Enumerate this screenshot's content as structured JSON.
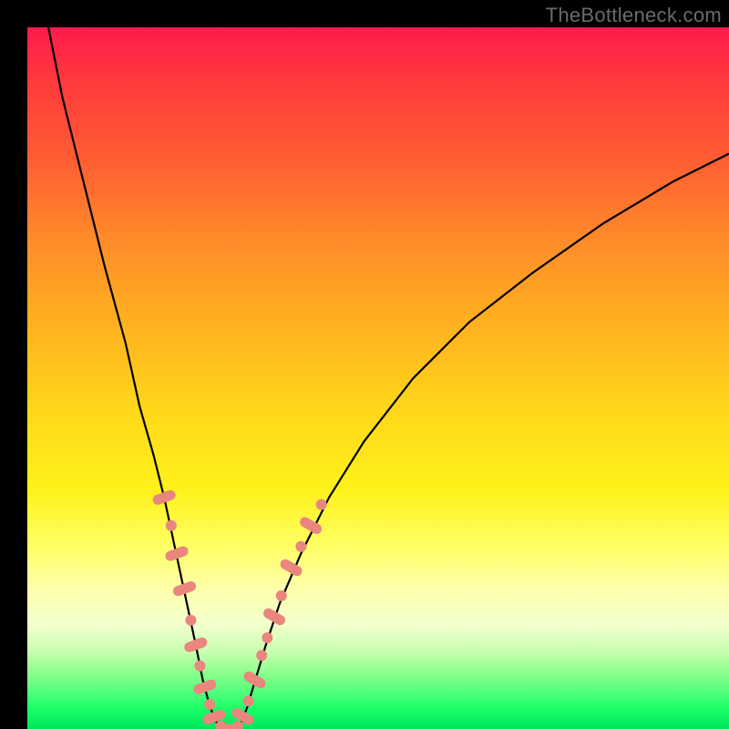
{
  "watermark": "TheBottleneck.com",
  "chart_data": {
    "type": "line",
    "title": "",
    "xlabel": "",
    "ylabel": "",
    "xlim": [
      0,
      100
    ],
    "ylim": [
      0,
      100
    ],
    "grid": false,
    "legend": false,
    "series": [
      {
        "name": "left-curve",
        "x": [
          3,
          5,
          8,
          11,
          14,
          16,
          18,
          19.5,
          21,
          22.5,
          24,
          25,
          25.8,
          26.3,
          26.8,
          27.2,
          27.5
        ],
        "values": [
          100,
          90,
          78,
          66,
          55,
          46,
          39,
          33,
          26,
          19,
          12,
          7,
          4,
          2.5,
          1.3,
          0.5,
          0
        ]
      },
      {
        "name": "right-curve",
        "x": [
          30,
          30.5,
          31.3,
          32.5,
          34,
          36,
          39,
          43,
          48,
          55,
          63,
          72,
          82,
          92,
          100
        ],
        "values": [
          0,
          1,
          3,
          7,
          12,
          18,
          25,
          33,
          41,
          50,
          58,
          65,
          72,
          78,
          82
        ]
      }
    ],
    "markers": [
      {
        "curve": "left-curve",
        "x": 19.5,
        "y": 33,
        "shape": "pill"
      },
      {
        "curve": "left-curve",
        "x": 20.5,
        "y": 29,
        "shape": "dot"
      },
      {
        "curve": "left-curve",
        "x": 21.3,
        "y": 25,
        "shape": "pill"
      },
      {
        "curve": "left-curve",
        "x": 22.4,
        "y": 20,
        "shape": "pill"
      },
      {
        "curve": "left-curve",
        "x": 23.3,
        "y": 15.5,
        "shape": "dot"
      },
      {
        "curve": "left-curve",
        "x": 24.0,
        "y": 12,
        "shape": "pill"
      },
      {
        "curve": "left-curve",
        "x": 24.6,
        "y": 9,
        "shape": "dot"
      },
      {
        "curve": "left-curve",
        "x": 25.3,
        "y": 6,
        "shape": "pill"
      },
      {
        "curve": "left-curve",
        "x": 26.0,
        "y": 3.5,
        "shape": "dot"
      },
      {
        "curve": "left-curve",
        "x": 26.6,
        "y": 1.7,
        "shape": "pill"
      },
      {
        "curve": "left-curve",
        "x": 27.6,
        "y": 0.4,
        "shape": "dot"
      },
      {
        "curve": "valley",
        "x": 28.7,
        "y": 0.0,
        "shape": "pill"
      },
      {
        "curve": "right-curve",
        "x": 30.0,
        "y": 0.4,
        "shape": "dot"
      },
      {
        "curve": "right-curve",
        "x": 30.7,
        "y": 1.8,
        "shape": "pill"
      },
      {
        "curve": "right-curve",
        "x": 31.5,
        "y": 4,
        "shape": "dot"
      },
      {
        "curve": "right-curve",
        "x": 32.4,
        "y": 7,
        "shape": "pill"
      },
      {
        "curve": "right-curve",
        "x": 33.4,
        "y": 10.5,
        "shape": "dot"
      },
      {
        "curve": "right-curve",
        "x": 34.2,
        "y": 13,
        "shape": "dot"
      },
      {
        "curve": "right-curve",
        "x": 35.2,
        "y": 16,
        "shape": "pill"
      },
      {
        "curve": "right-curve",
        "x": 36.2,
        "y": 19,
        "shape": "dot"
      },
      {
        "curve": "right-curve",
        "x": 37.6,
        "y": 23,
        "shape": "pill"
      },
      {
        "curve": "right-curve",
        "x": 39.0,
        "y": 26,
        "shape": "dot"
      },
      {
        "curve": "right-curve",
        "x": 40.4,
        "y": 29,
        "shape": "pill"
      },
      {
        "curve": "right-curve",
        "x": 41.9,
        "y": 32,
        "shape": "dot"
      }
    ],
    "background_gradient": {
      "top": "#ff1a4d",
      "mid": "#fff21a",
      "bottom": "#00e65c"
    }
  }
}
